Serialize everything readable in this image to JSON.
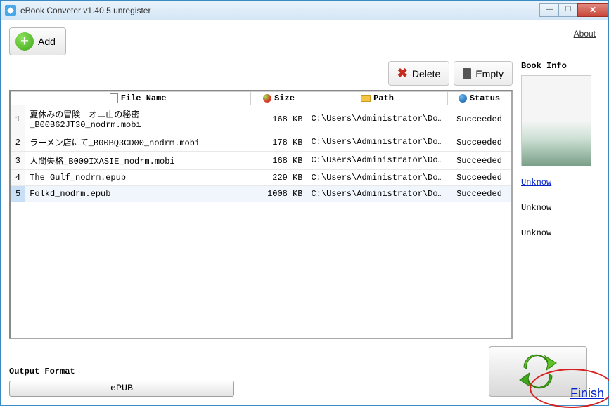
{
  "window": {
    "title": "eBook Conveter v1.40.5    unregister"
  },
  "links": {
    "about": "About",
    "finish": "Finish"
  },
  "buttons": {
    "add": "Add",
    "delete": "Delete",
    "empty": "Empty",
    "format": "ePUB"
  },
  "labels": {
    "output_format": "Output Format",
    "book_info": "Book Info"
  },
  "columns": {
    "filename": "File Name",
    "size": "Size",
    "path": "Path",
    "status": "Status"
  },
  "files": [
    {
      "idx": "1",
      "name": "夏休みの冒険　オニ山の秘密_B00B62JT30_nodrm.mobi",
      "size": "168 KB",
      "path": "C:\\Users\\Administrator\\Document…",
      "status": "Succeeded"
    },
    {
      "idx": "2",
      "name": "ラーメン店にて_B00BQ3CD00_nodrm.mobi",
      "size": "178 KB",
      "path": "C:\\Users\\Administrator\\Document…",
      "status": "Succeeded"
    },
    {
      "idx": "3",
      "name": "人間失格_B009IXASIE_nodrm.mobi",
      "size": "168 KB",
      "path": "C:\\Users\\Administrator\\Document…",
      "status": "Succeeded"
    },
    {
      "idx": "4",
      "name": "The Gulf_nodrm.epub",
      "size": "229 KB",
      "path": "C:\\Users\\Administrator\\Document…",
      "status": "Succeeded"
    },
    {
      "idx": "5",
      "name": "Folkd_nodrm.epub",
      "size": "1008 KB",
      "path": "C:\\Users\\Administrator\\Document…",
      "status": "Succeeded"
    }
  ],
  "selected_index": 4,
  "book_info": {
    "line1": "Unknow",
    "line2": "Unknow",
    "line3": "Unknow"
  }
}
